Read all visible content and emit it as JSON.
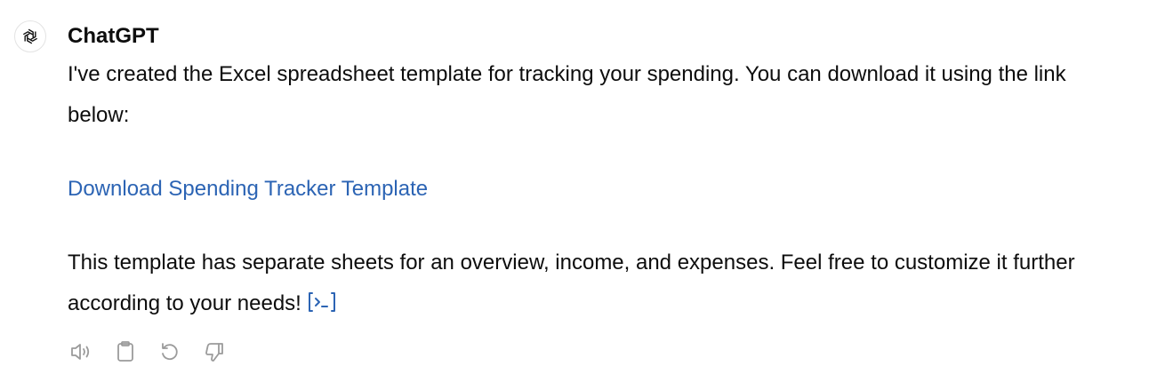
{
  "message": {
    "sender": "ChatGPT",
    "avatar_icon": "openai-logo-icon",
    "paragraph_1": "I've created the Excel spreadsheet template for tracking your spending. You can download it using the link below:",
    "link_text": "Download Spending Tracker Template",
    "paragraph_2": "This template has separate sheets for an overview, income, and expenses. Feel free to customize it further according to your needs!",
    "code_icon": "view-analysis-icon"
  },
  "actions": {
    "icons": [
      "speaker-icon",
      "clipboard-icon",
      "regenerate-icon",
      "thumbs-down-icon"
    ]
  },
  "colors": {
    "link": "#2c64b4",
    "text": "#0d0d0d",
    "icon": "#9b9b9b"
  }
}
